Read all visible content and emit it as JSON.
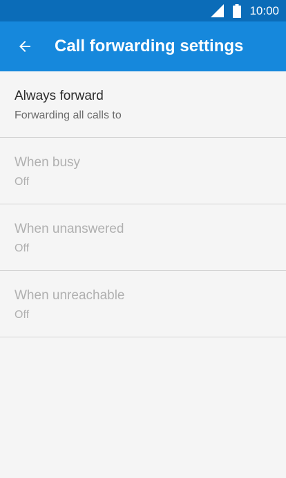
{
  "status_bar": {
    "time": "10:00",
    "icons": [
      "signal-icon",
      "battery-icon"
    ]
  },
  "app_bar": {
    "back_icon": "arrow-back-icon",
    "title": "Call forwarding settings"
  },
  "settings": {
    "items": [
      {
        "title": "Always forward",
        "summary": "Forwarding all calls to",
        "enabled": true
      },
      {
        "title": "When busy",
        "summary": "Off",
        "enabled": false
      },
      {
        "title": "When unanswered",
        "summary": "Off",
        "enabled": false
      },
      {
        "title": "When unreachable",
        "summary": "Off",
        "enabled": false
      }
    ]
  },
  "colors": {
    "status_bar": "#0b6cb8",
    "app_bar": "#1688dc",
    "background": "#f5f5f5",
    "divider": "#d4d4d4",
    "text_primary": "#2b2b2b",
    "text_secondary": "#6b6b6b",
    "text_disabled": "#b0b0b0"
  }
}
